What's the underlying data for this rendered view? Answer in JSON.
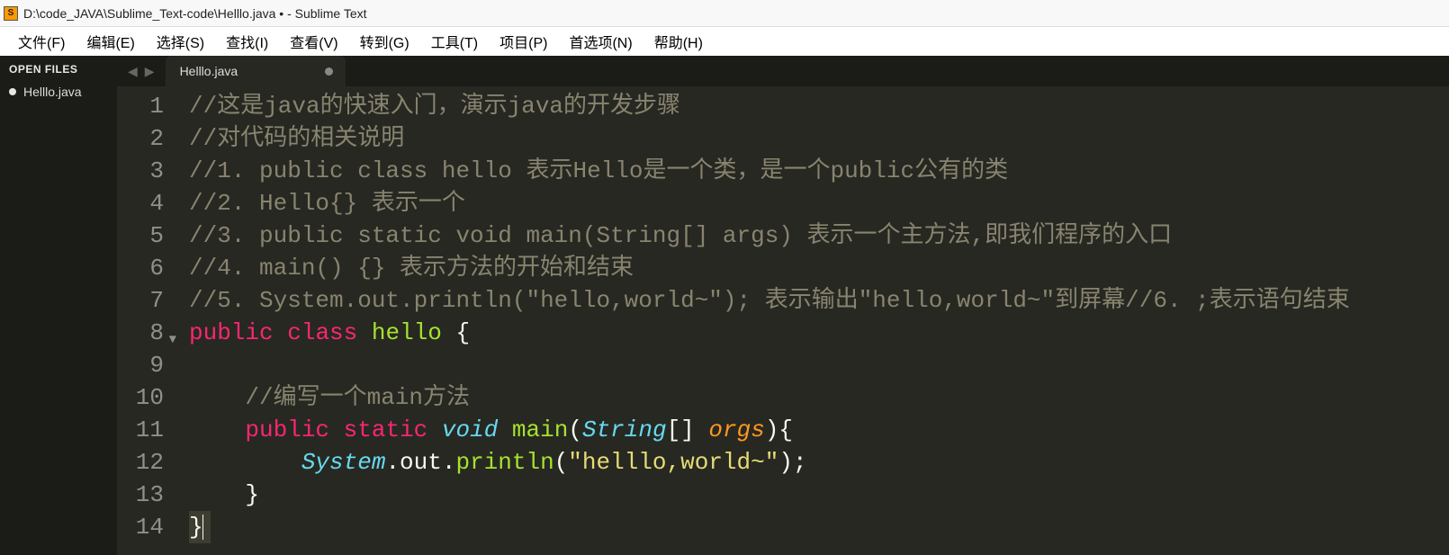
{
  "window": {
    "title": "D:\\code_JAVA\\Sublime_Text-code\\Helllo.java • - Sublime Text",
    "app_icon_letter": "S"
  },
  "menu": {
    "file": "文件(F)",
    "edit": "编辑(E)",
    "select": "选择(S)",
    "find": "查找(I)",
    "view": "查看(V)",
    "goto": "转到(G)",
    "tools": "工具(T)",
    "project": "项目(P)",
    "prefs": "首选项(N)",
    "help": "帮助(H)"
  },
  "sidebar": {
    "header": "OPEN FILES",
    "files": [
      {
        "name": "Helllo.java",
        "dirty": true
      }
    ]
  },
  "tabbar": {
    "nav_back": "◀",
    "nav_fwd": "▶",
    "tabs": [
      {
        "name": "Helllo.java",
        "dirty": true
      }
    ]
  },
  "code": {
    "lines": [
      {
        "n": "1",
        "tokens": [
          {
            "c": "tok-comment",
            "t": "//这是java的快速入门，演示java的开发步骤"
          }
        ]
      },
      {
        "n": "2",
        "tokens": [
          {
            "c": "tok-comment",
            "t": "//对代码的相关说明"
          }
        ]
      },
      {
        "n": "3",
        "tokens": [
          {
            "c": "tok-comment",
            "t": "//1. public class hello 表示Hello是一个类，是一个public公有的类"
          }
        ]
      },
      {
        "n": "4",
        "tokens": [
          {
            "c": "tok-comment",
            "t": "//2. Hello{} 表示一个"
          }
        ]
      },
      {
        "n": "5",
        "tokens": [
          {
            "c": "tok-comment",
            "t": "//3. public static void main(String[] args) 表示一个主方法,即我们程序的入口"
          }
        ]
      },
      {
        "n": "6",
        "tokens": [
          {
            "c": "tok-comment",
            "t": "//4. main() {} 表示方法的开始和结束"
          }
        ]
      },
      {
        "n": "7",
        "tokens": [
          {
            "c": "tok-comment",
            "t": "//5. System.out.println(\"hello,world~\"); 表示输出\"hello,world~\"到屏幕//6. ;表示语句结束"
          }
        ]
      },
      {
        "n": "8",
        "fold": true,
        "tokens": [
          {
            "c": "tok-keyword",
            "t": "public"
          },
          {
            "c": "tok-punct",
            "t": " "
          },
          {
            "c": "tok-keyword",
            "t": "class"
          },
          {
            "c": "tok-punct",
            "t": " "
          },
          {
            "c": "tok-class",
            "t": "hello"
          },
          {
            "c": "tok-punct",
            "t": " {"
          }
        ]
      },
      {
        "n": "9",
        "tokens": [
          {
            "c": "tok-punct",
            "t": ""
          }
        ]
      },
      {
        "n": "10",
        "tokens": [
          {
            "c": "tok-punct",
            "t": "    "
          },
          {
            "c": "tok-comment",
            "t": "//编写一个main方法"
          }
        ]
      },
      {
        "n": "11",
        "tokens": [
          {
            "c": "tok-punct",
            "t": "    "
          },
          {
            "c": "tok-keyword",
            "t": "public"
          },
          {
            "c": "tok-punct",
            "t": " "
          },
          {
            "c": "tok-keyword",
            "t": "static"
          },
          {
            "c": "tok-punct",
            "t": " "
          },
          {
            "c": "tok-storage",
            "t": "void"
          },
          {
            "c": "tok-punct",
            "t": " "
          },
          {
            "c": "tok-func",
            "t": "main"
          },
          {
            "c": "tok-punct",
            "t": "("
          },
          {
            "c": "tok-type",
            "t": "String"
          },
          {
            "c": "tok-punct",
            "t": "[] "
          },
          {
            "c": "tok-param",
            "t": "orgs"
          },
          {
            "c": "tok-punct",
            "t": "){"
          }
        ]
      },
      {
        "n": "12",
        "tokens": [
          {
            "c": "tok-punct",
            "t": "        "
          },
          {
            "c": "tok-type",
            "t": "System"
          },
          {
            "c": "tok-punct",
            "t": ".out."
          },
          {
            "c": "tok-func",
            "t": "println"
          },
          {
            "c": "tok-punct",
            "t": "("
          },
          {
            "c": "tok-string",
            "t": "\"helllo,world~\""
          },
          {
            "c": "tok-punct",
            "t": ");"
          }
        ]
      },
      {
        "n": "13",
        "tokens": [
          {
            "c": "tok-punct",
            "t": "    }"
          }
        ]
      },
      {
        "n": "14",
        "highlight": true,
        "cursor_after": true,
        "tokens": [
          {
            "c": "tok-punct",
            "t": "}"
          }
        ]
      }
    ]
  }
}
